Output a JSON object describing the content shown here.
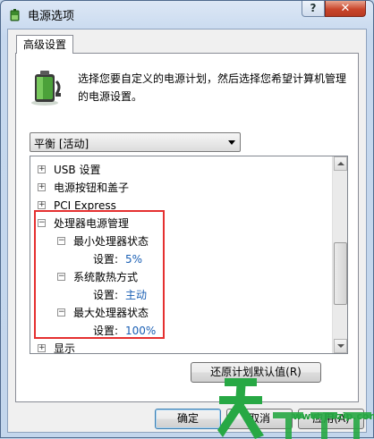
{
  "window": {
    "title": "电源选项",
    "help_label": "?",
    "close_label": "✕"
  },
  "tab": {
    "label": "高级设置"
  },
  "description": "选择您要自定义的电源计划，然后选择您希望计算机管理的电源设置。",
  "plan_select": {
    "value": "平衡 [活动]"
  },
  "tree": [
    {
      "expander": "+",
      "label": "USB 设置"
    },
    {
      "expander": "+",
      "label": "电源按钮和盖子"
    },
    {
      "expander": "+",
      "label": "PCI Express"
    },
    {
      "expander": "−",
      "label": "处理器电源管理"
    },
    {
      "expander": "−",
      "label": "最小处理器状态"
    },
    {
      "setting_label": "设置:",
      "value": "5%"
    },
    {
      "expander": "−",
      "label": "系统散热方式"
    },
    {
      "setting_label": "设置:",
      "value": "主动"
    },
    {
      "expander": "−",
      "label": "最大处理器状态"
    },
    {
      "setting_label": "设置:",
      "value": "100%"
    },
    {
      "expander": "+",
      "label": "显示"
    }
  ],
  "buttons": {
    "restore": "还原计划默认值(R)",
    "ok": "确定",
    "cancel": "取消",
    "apply": "应用(A)"
  },
  "watermark": {
    "url": "www.TTzip.com",
    "brand": "天下载"
  },
  "colors": {
    "highlight_border": "#e53030",
    "setting_value": "#1a5fb4",
    "watermark": "#1f9d3a"
  }
}
